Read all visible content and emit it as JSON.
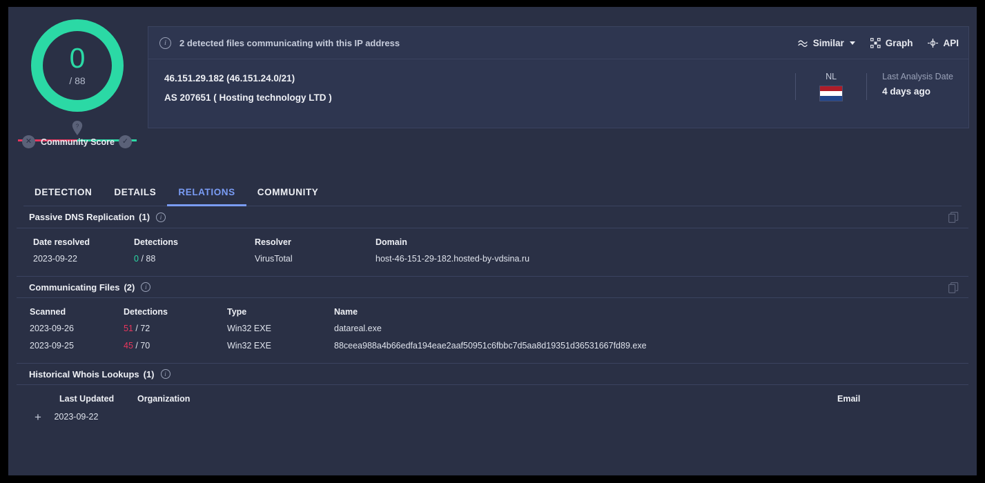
{
  "score": {
    "value": "0",
    "total": "/ 88",
    "ring_color": "#2bd9a5",
    "community_label": "Community Score",
    "bar_left_color": "#e8365d",
    "bar_right_color": "#2bd9a5"
  },
  "card": {
    "banner_text": "2 detected files communicating with this IP address",
    "ip_line": "46.151.29.182  (46.151.24.0/21)",
    "as_line": "AS 207651  ( Hosting technology LTD )",
    "actions": [
      {
        "label": "Similar",
        "icon": "similar-icon",
        "has_caret": true
      },
      {
        "label": "Graph",
        "icon": "graph-icon",
        "has_caret": false
      },
      {
        "label": "API",
        "icon": "api-icon",
        "has_caret": false
      }
    ],
    "country_code": "NL",
    "country_flag": "netherlands-flag",
    "last_analysis_label": "Last Analysis Date",
    "last_analysis_value": "4 days ago"
  },
  "tabs": [
    {
      "label": "DETECTION",
      "active": false
    },
    {
      "label": "DETAILS",
      "active": false
    },
    {
      "label": "RELATIONS",
      "active": true
    },
    {
      "label": "COMMUNITY",
      "active": false
    }
  ],
  "passive_dns": {
    "title": "Passive DNS Replication",
    "count": "(1)",
    "columns": [
      "Date resolved",
      "Detections",
      "Resolver",
      "Domain"
    ],
    "rows": [
      {
        "date": "2023-09-22",
        "detections_hits": "0",
        "detections_total": "/ 88",
        "detections_state": "good",
        "resolver": "VirusTotal",
        "domain": "host-46-151-29-182.hosted-by-vdsina.ru"
      }
    ]
  },
  "communicating_files": {
    "title": "Communicating Files",
    "count": "(2)",
    "columns": [
      "Scanned",
      "Detections",
      "Type",
      "Name"
    ],
    "rows": [
      {
        "scanned": "2023-09-26",
        "detections_hits": "51",
        "detections_total": "/ 72",
        "detections_state": "bad",
        "type": "Win32 EXE",
        "name": "datareal.exe"
      },
      {
        "scanned": "2023-09-25",
        "detections_hits": "45",
        "detections_total": "/ 70",
        "detections_state": "bad",
        "type": "Win32 EXE",
        "name": "88ceea988a4b66edfa194eae2aaf50951c6fbbc7d5aa8d19351d36531667fd89.exe"
      }
    ]
  },
  "whois": {
    "title": "Historical Whois Lookups",
    "count": "(1)",
    "columns": [
      "Last Updated",
      "Organization",
      "Email"
    ],
    "rows": [
      {
        "last_updated": "2023-09-22",
        "organization": "",
        "email": ""
      }
    ]
  }
}
